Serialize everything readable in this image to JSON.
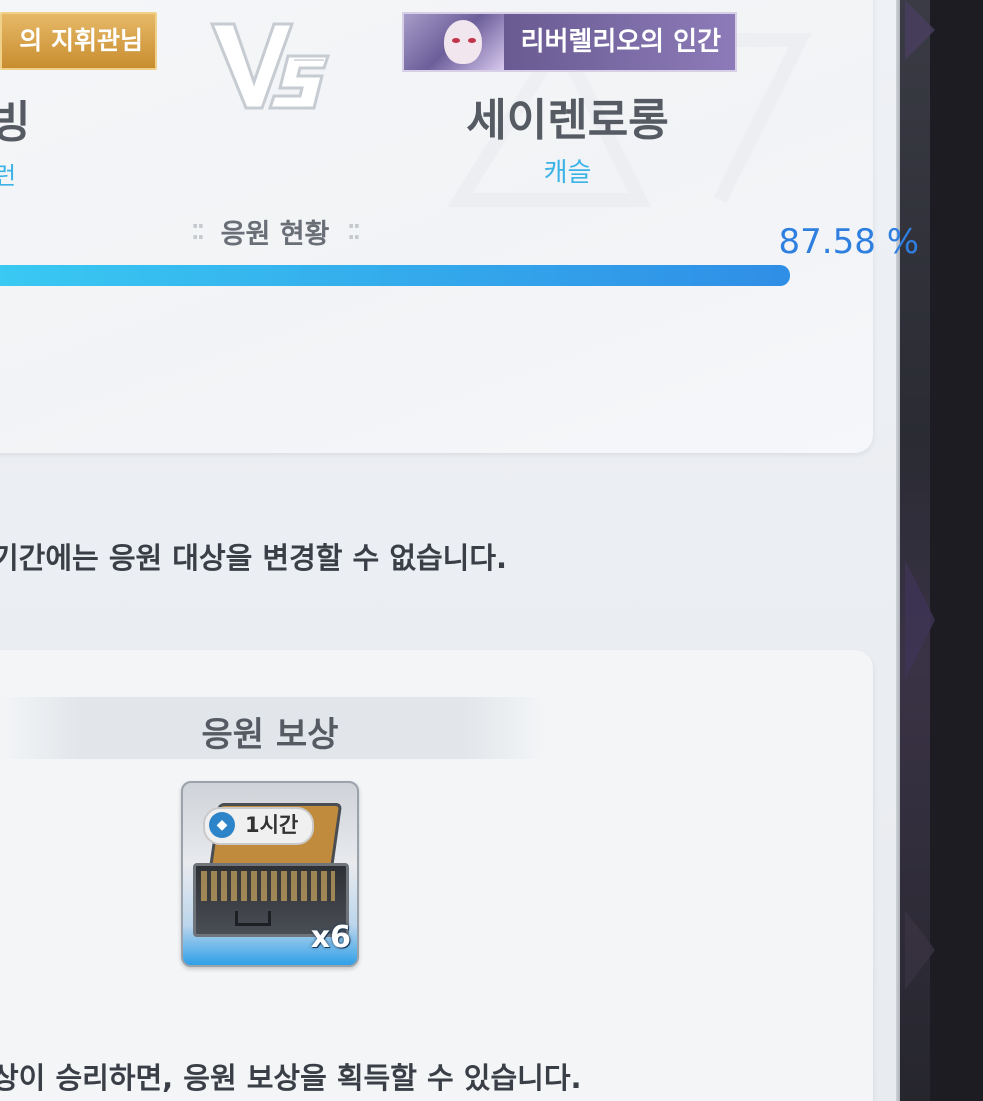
{
  "match": {
    "left_title_partial": "의 지휘관님",
    "left_name_partial": "빙",
    "left_sub_partial": "런",
    "vs_label": "VS",
    "right_title": "리버렐리오의 인간",
    "right_name": "세이렌로롱",
    "right_sub": "캐슬"
  },
  "support": {
    "status_label": "응원 현황",
    "percent_text": "87.58 %",
    "progress_fraction": 0.8758
  },
  "notices": {
    "lock_notice_partial": "기간에는 응원 대상을 변경할 수 없습니다.",
    "reward_notice_partial": "상이 승리하면, 응원 보상을 획득할 수 있습니다."
  },
  "reward": {
    "title": "응원 보상",
    "item_duration": "1시간",
    "item_quantity": "x6",
    "item_icon": "briefcase-icon"
  },
  "colors": {
    "accent_blue": "#2f7fe0",
    "progress_start": "#39c9f2",
    "progress_end": "#2f8ee6",
    "sub_label_cyan": "#3bb3e6",
    "left_title_gold": "#c98d2f",
    "right_title_purple": "#5a4c82"
  }
}
